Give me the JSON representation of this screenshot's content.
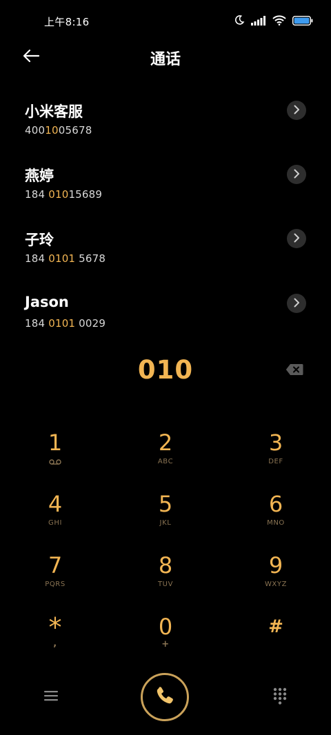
{
  "status_bar": {
    "time": "上午8:16",
    "icons": [
      "moon-icon",
      "signal-icon",
      "wifi-icon",
      "battery-icon"
    ]
  },
  "header": {
    "title": "通话",
    "back_icon": "arrow-left-icon"
  },
  "contacts": [
    {
      "name": "小米客服",
      "number_pre": "400",
      "number_hl": "10",
      "number_post": "05678"
    },
    {
      "name": "燕婷",
      "number_pre": "184 ",
      "number_hl": "010",
      "number_post": "15689"
    },
    {
      "name": "子玲",
      "number_pre": "184 ",
      "number_hl": "0101",
      "number_post": " 5678"
    },
    {
      "name": "Jason",
      "number_pre": "184 ",
      "number_hl": "0101",
      "number_post": " 0029"
    }
  ],
  "dialed_number": "010",
  "keypad": [
    {
      "digit": "1",
      "letters": "",
      "sub_icon": "voicemail-icon"
    },
    {
      "digit": "2",
      "letters": "ABC"
    },
    {
      "digit": "3",
      "letters": "DEF"
    },
    {
      "digit": "4",
      "letters": "GHI"
    },
    {
      "digit": "5",
      "letters": "JKL"
    },
    {
      "digit": "6",
      "letters": "MNO"
    },
    {
      "digit": "7",
      "letters": "PQRS"
    },
    {
      "digit": "8",
      "letters": "TUV"
    },
    {
      "digit": "9",
      "letters": "WXYZ"
    },
    {
      "digit": "*",
      "letters": ","
    },
    {
      "digit": "0",
      "letters": "+"
    },
    {
      "digit": "#",
      "letters": ""
    }
  ],
  "bottom_bar": {
    "left_icon": "menu-icon",
    "center_icon": "phone-call-icon",
    "right_icon": "dialpad-icon"
  },
  "colors": {
    "accent": "#f2b553",
    "background": "#000000",
    "call_ring": "#caa25a"
  }
}
